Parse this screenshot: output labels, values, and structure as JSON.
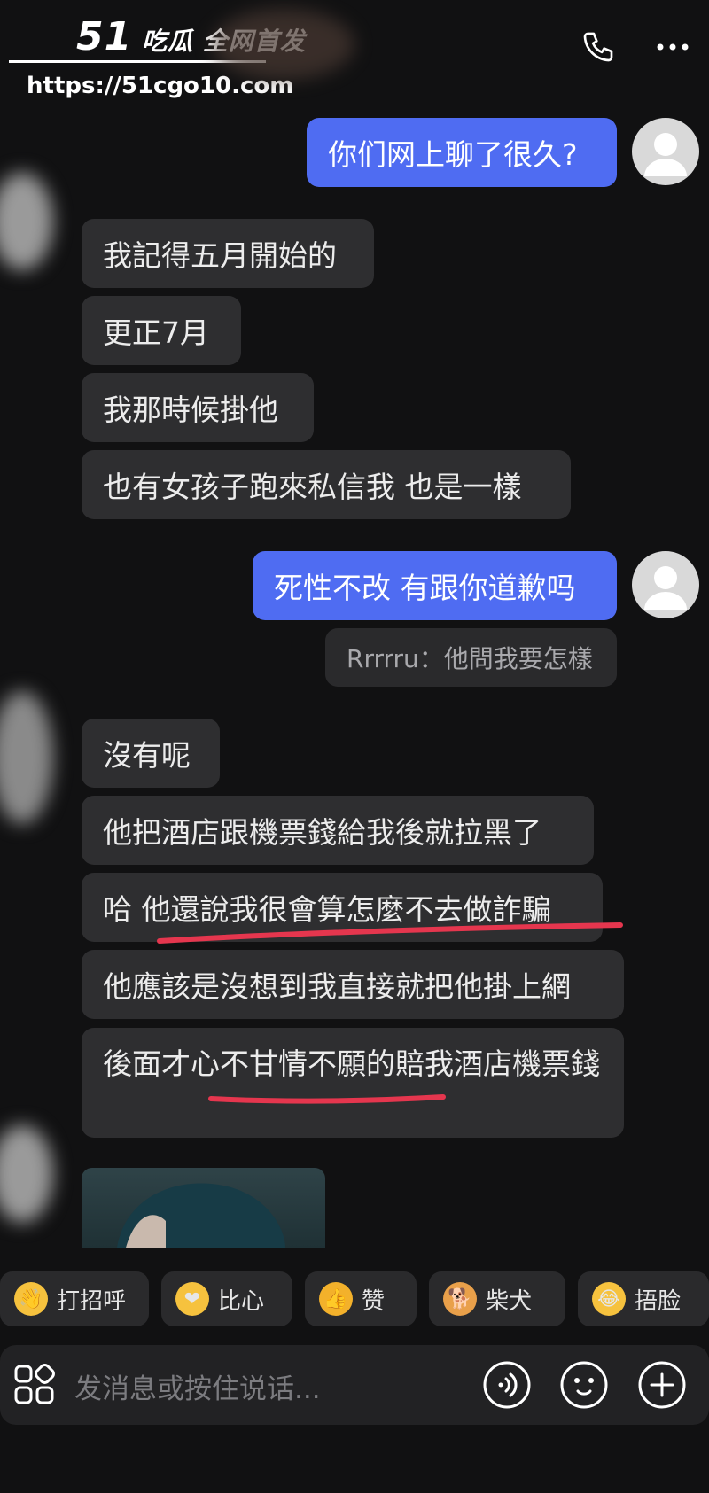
{
  "watermark": {
    "logo_number": "51",
    "logo_text": "吃瓜 全网首发",
    "url": "https://51cgo10.com"
  },
  "header": {
    "call_icon": "phone-icon",
    "menu_icon": "more-icon"
  },
  "messages": [
    {
      "side": "out",
      "text": "你们网上聊了很久?"
    },
    {
      "side": "in",
      "text": "我記得五月開始的"
    },
    {
      "side": "in",
      "text": "更正7月"
    },
    {
      "side": "in",
      "text": "我那時候掛他"
    },
    {
      "side": "in",
      "text": "也有女孩子跑來私信我 也是一樣"
    },
    {
      "side": "out",
      "text": "死性不改 有跟你道歉吗"
    },
    {
      "side": "out-quote",
      "text": "Rrrrru：他問我要怎樣"
    },
    {
      "side": "in",
      "text": "沒有呢"
    },
    {
      "side": "in",
      "text": "他把酒店跟機票錢給我後就拉黑了"
    },
    {
      "side": "in",
      "text": "哈 他還說我很會算怎麼不去做詐騙"
    },
    {
      "side": "in",
      "text": "他應該是沒想到我直接就把他掛上網"
    },
    {
      "side": "in",
      "text": "後面才心不甘情不願的賠我酒店機票錢"
    }
  ],
  "quick_replies": [
    {
      "icon": "wave-emoji-icon",
      "label": "打招呼"
    },
    {
      "icon": "heart-hands-emoji-icon",
      "label": "比心"
    },
    {
      "icon": "thumbs-up-emoji-icon",
      "label": "赞"
    },
    {
      "icon": "shiba-emoji-icon",
      "label": "柴犬"
    },
    {
      "icon": "facepalm-emoji-icon",
      "label": "捂脸"
    }
  ],
  "input": {
    "placeholder": "发消息或按住说话..."
  },
  "colors": {
    "outgoing_bubble": "#4f6cf2",
    "incoming_bubble": "#2e2e30",
    "background": "#111112",
    "underline": "#e5364e"
  }
}
